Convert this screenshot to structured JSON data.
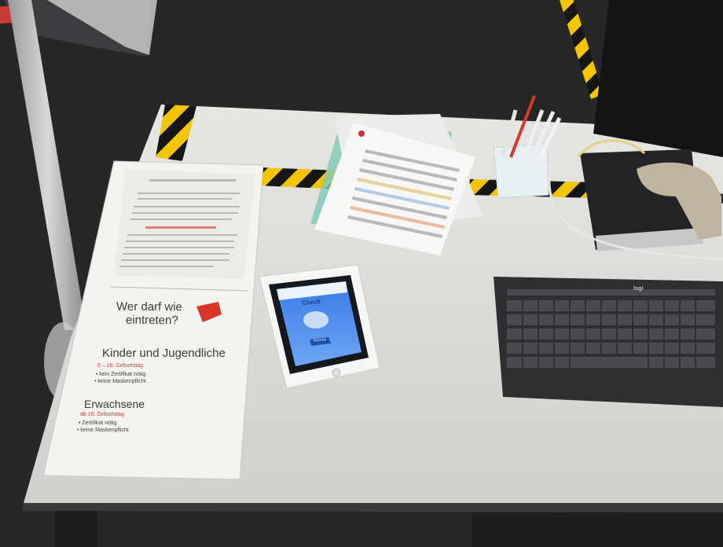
{
  "colors": {
    "carpet": "#2b2b2c",
    "desk": "#dcdcda",
    "hazard_yellow": "#f2c500",
    "accent_red": "#d9362b",
    "app_blue": "#2f6bd8"
  },
  "poster": {
    "heading": "Wer darf wie eintreten?",
    "heading_line1": "Wer darf wie",
    "heading_line2": "eintreten?",
    "group_children": {
      "title": "Kinder und Jugendliche",
      "age": "0 – 16. Geburtstag",
      "bullets": [
        "kein Zertifikat nötig",
        "keine Maskenpflicht"
      ]
    },
    "group_adults": {
      "title": "Erwachsene",
      "age": "ab 16. Geburtstag",
      "bullets": [
        "Zertifikat nötig",
        "keine Maskenpflicht"
      ]
    }
  },
  "ipad_app": {
    "title": "Check",
    "button_label": "PRÜFEN"
  },
  "keyboard": {
    "brand": "logi"
  },
  "icons": [
    "swiss-crest-icon",
    "certificate-icon",
    "qr-scan-icon"
  ]
}
